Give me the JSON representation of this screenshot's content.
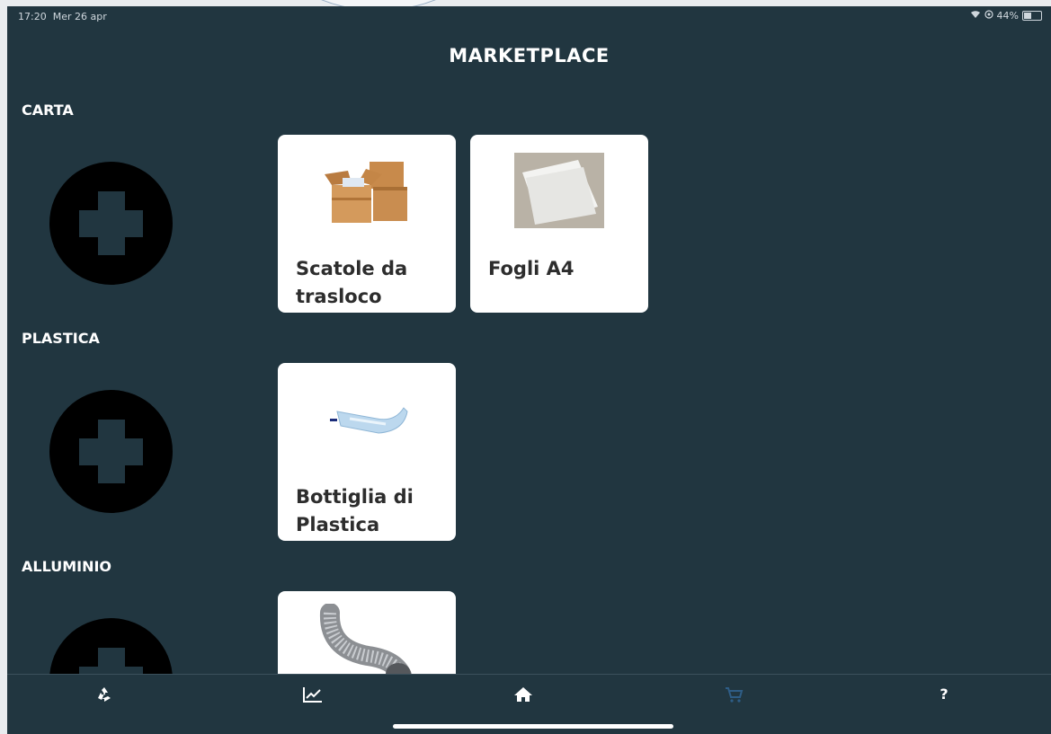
{
  "status_bar": {
    "time": "17:20",
    "date": "Mer 26 apr",
    "battery": "44%",
    "battery_level": 0.44
  },
  "header": {
    "title": "MARKETPLACE"
  },
  "sections": [
    {
      "label": "CARTA",
      "items": [
        {
          "title": "Scatole da trasloco",
          "image": "cardboard-boxes-image"
        },
        {
          "title": "Fogli A4",
          "image": "paper-sheets-image"
        }
      ]
    },
    {
      "label": "PLASTICA",
      "items": [
        {
          "title": "Bottiglia di Plastica",
          "image": "plastic-bottle-image"
        }
      ]
    },
    {
      "label": "ALLUMINIO",
      "items": [
        {
          "title": "",
          "image": "aluminum-duct-image"
        }
      ]
    }
  ],
  "tabbar": {
    "items": [
      {
        "icon": "recycle-icon",
        "color": "#ffffff"
      },
      {
        "icon": "chart-icon",
        "color": "#ffffff"
      },
      {
        "icon": "home-icon",
        "color": "#ffffff"
      },
      {
        "icon": "cart-icon",
        "color": "#2e5d86"
      },
      {
        "icon": "help-icon",
        "label": "?",
        "color": "#ffffff"
      }
    ]
  },
  "colors": {
    "background": "#213640",
    "card": "#ffffff",
    "add_button": "#000000"
  }
}
